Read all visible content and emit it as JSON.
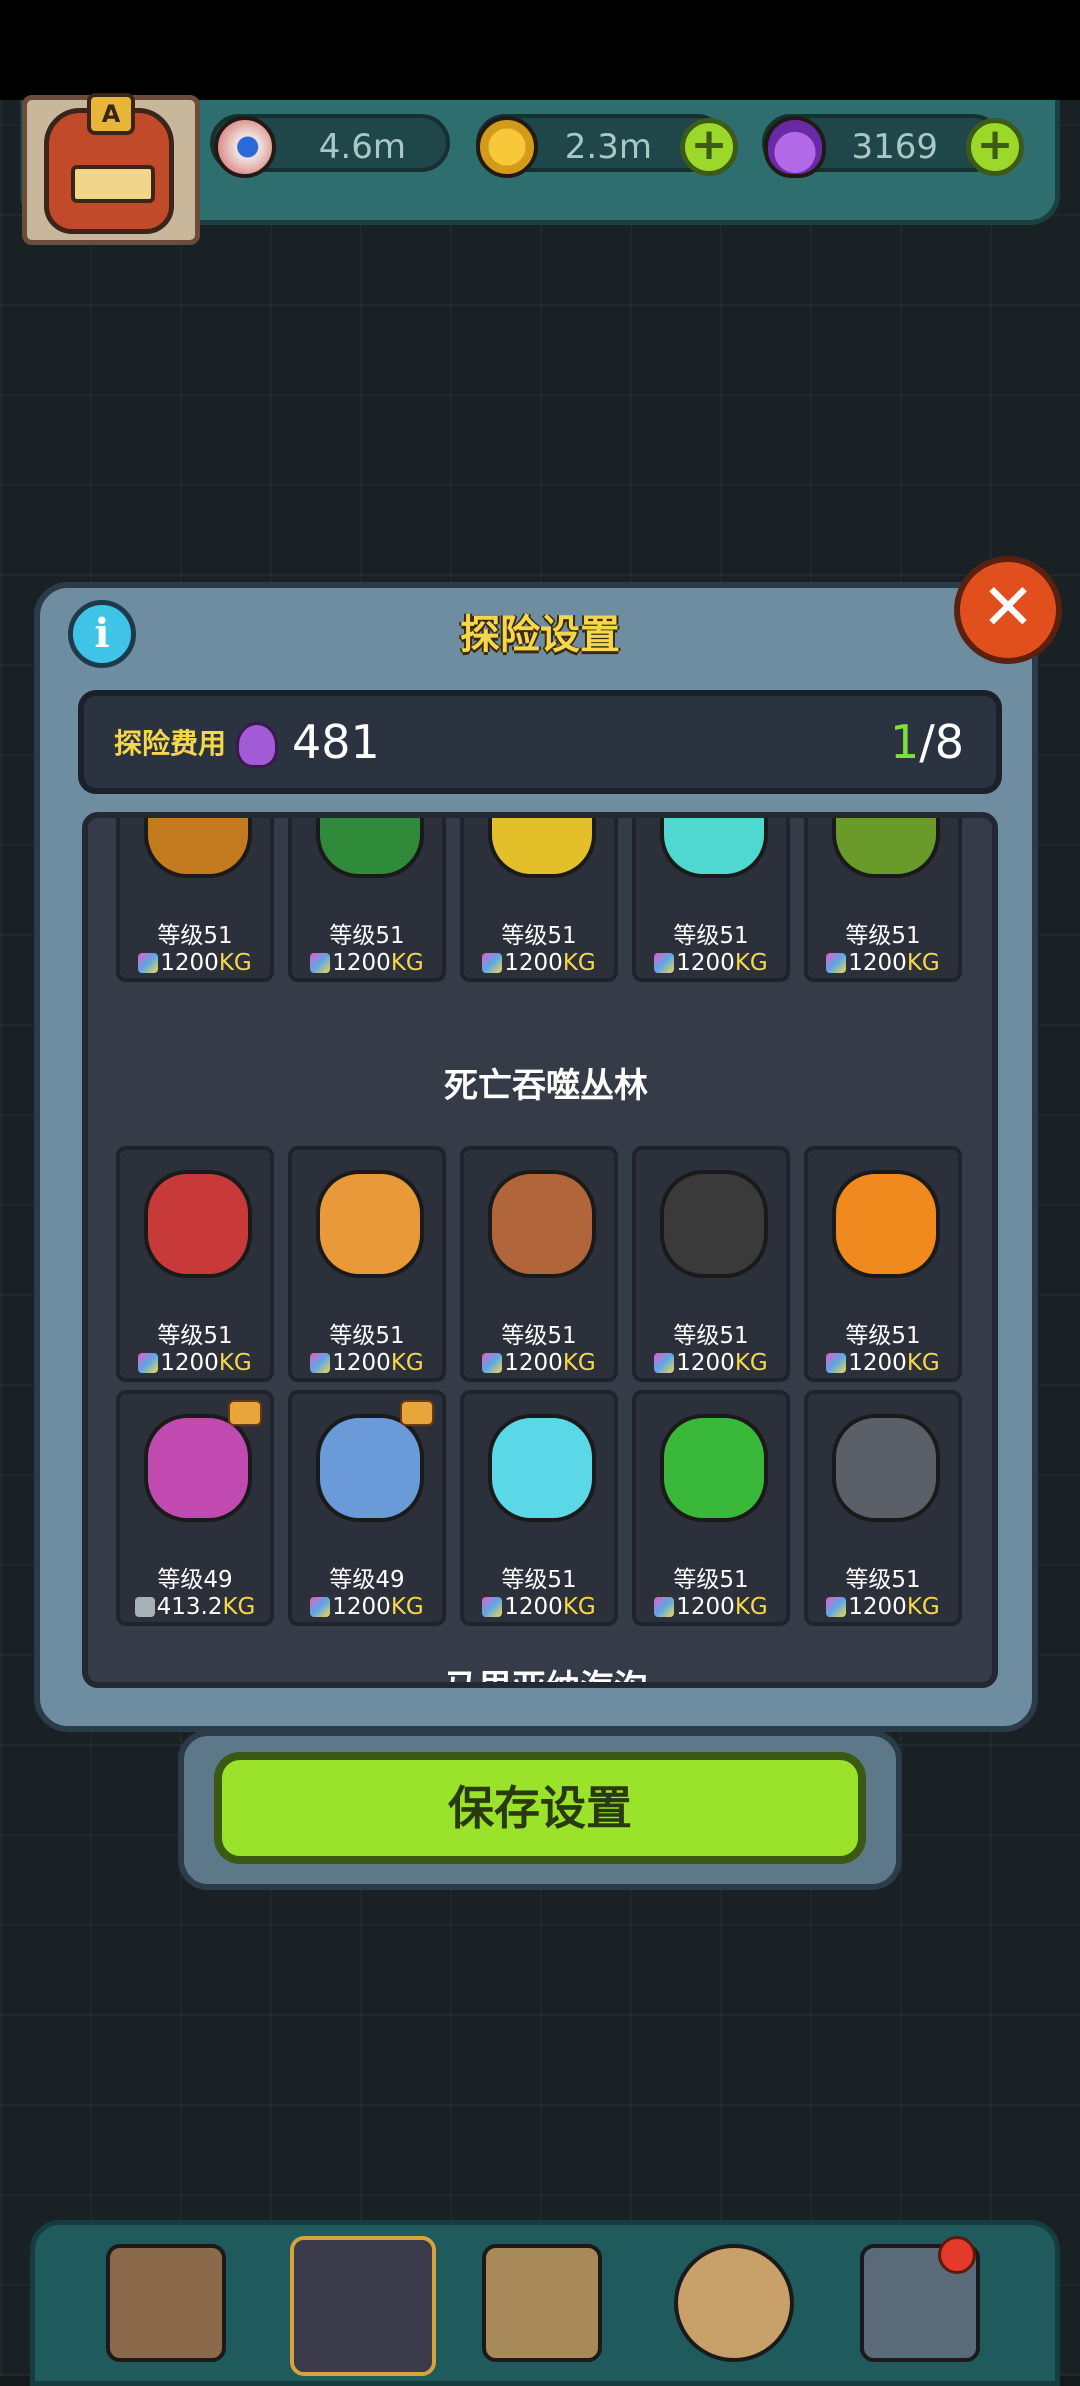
{
  "hud": {
    "eyeballs": "4.6m",
    "coins": "2.3m",
    "potions": "3169",
    "avatar_badge": "A"
  },
  "dialog": {
    "title": "探险设置",
    "cost_label": "探险费用",
    "cost_value": "481",
    "count_current": "1",
    "count_total": "/8",
    "close_symbol": "✕",
    "info_symbol": "i"
  },
  "top_row": [
    {
      "level": "等级51",
      "weight": "1200",
      "unit": "KG",
      "color": "#c47a1e"
    },
    {
      "level": "等级51",
      "weight": "1200",
      "unit": "KG",
      "color": "#2f8a3a"
    },
    {
      "level": "等级51",
      "weight": "1200",
      "unit": "KG",
      "color": "#e3c02a"
    },
    {
      "level": "等级51",
      "weight": "1200",
      "unit": "KG",
      "color": "#4ed8d0"
    },
    {
      "level": "等级51",
      "weight": "1200",
      "unit": "KG",
      "color": "#6a9a2a"
    }
  ],
  "section": {
    "title": "死亡吞噬丛林",
    "next_title": "马里亚纳海沟",
    "rows": [
      [
        {
          "level": "等级51",
          "weight": "1200",
          "unit": "KG",
          "color": "#c83a3a"
        },
        {
          "level": "等级51",
          "weight": "1200",
          "unit": "KG",
          "color": "#e89a3a"
        },
        {
          "level": "等级51",
          "weight": "1200",
          "unit": "KG",
          "color": "#b0663a"
        },
        {
          "level": "等级51",
          "weight": "1200",
          "unit": "KG",
          "color": "#3a3a3a"
        },
        {
          "level": "等级51",
          "weight": "1200",
          "unit": "KG",
          "color": "#f08a1e"
        }
      ],
      [
        {
          "level": "等级49",
          "weight": "413.2",
          "unit": "KG",
          "color": "#c04ab0"
        },
        {
          "level": "等级49",
          "weight": "1200",
          "unit": "KG",
          "color": "#6a9ad8"
        },
        {
          "level": "等级51",
          "weight": "1200",
          "unit": "KG",
          "color": "#5ad8e8"
        },
        {
          "level": "等级51",
          "weight": "1200",
          "unit": "KG",
          "color": "#3ab83a"
        },
        {
          "level": "等级51",
          "weight": "1200",
          "unit": "KG",
          "color": "#5a5f68"
        }
      ]
    ]
  },
  "save_button": "保存设置",
  "colors": {
    "accent_yellow": "#f6d74a",
    "button_green": "#9be22a",
    "count_green": "#7ee03a"
  }
}
